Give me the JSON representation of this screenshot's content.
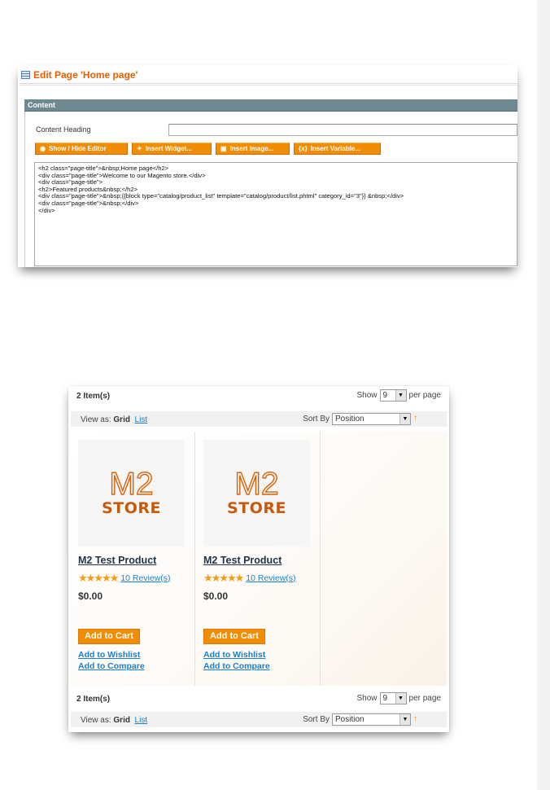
{
  "admin": {
    "title": "Edit Page 'Home page'",
    "section_header": "Content",
    "content_heading_label": "Content Heading",
    "content_heading_value": "",
    "buttons": {
      "show_hide": "Show / Hide Editor",
      "insert_widget": "Insert Widget...",
      "insert_image": "Insert Image...",
      "insert_variable": "Insert Variable..."
    },
    "editor_lines": [
      "<h2 class=\"page-title\">&nbsp;Home page</h2>",
      "<div class=\"page-title\">Welcome to our Magento store.</div>",
      "<div class=\"page-title\">",
      "<h2>Featured products&nbsp;</h2>",
      "<div class=\"page-title\">&nbsp;{{block type=\"catalog/product_list\" template=\"catalog/product/list.phtml\" category_id=\"3\"}}  &nbsp;</div>",
      "<div class=\"page-title\">&nbsp;</div>",
      "</div>"
    ]
  },
  "store": {
    "toolbar_top": {
      "count": "2 Item(s)",
      "show_label": "Show",
      "show_value": "9",
      "per_page": "per page",
      "view_as": "View as:",
      "view_grid": "Grid",
      "view_list": "List",
      "sort_by": "Sort By",
      "sort_value": "Position",
      "sort_dir_icon": "arrow-up-icon"
    },
    "toolbar_bottom": {
      "count": "2 Item(s)",
      "show_label": "Show",
      "show_value": "9",
      "per_page": "per page",
      "view_as": "View as:",
      "view_grid": "Grid",
      "view_list": "List",
      "sort_by": "Sort By",
      "sort_value": "Position"
    },
    "products": [
      {
        "logo_line1": "M2",
        "logo_line2": "STORE",
        "name": "M2 Test Product",
        "stars": "★★★★★",
        "reviews": "10 Review(s)",
        "price": "$0.00",
        "add_to_cart": "Add to Cart",
        "add_to_wishlist": "Add to Wishlist",
        "add_to_compare": "Add to Compare"
      },
      {
        "logo_line1": "M2",
        "logo_line2": "STORE",
        "name": "M2 Test Product",
        "stars": "★★★★★",
        "reviews": "10 Review(s)",
        "price": "$0.00",
        "add_to_cart": "Add to Cart",
        "add_to_wishlist": "Add to Wishlist",
        "add_to_compare": "Add to Compare"
      }
    ]
  },
  "colors": {
    "accent_orange": "#f18d05",
    "title_orange": "#eb5e00",
    "link_blue": "#1e7ec8",
    "section_header": "#6f8992"
  }
}
